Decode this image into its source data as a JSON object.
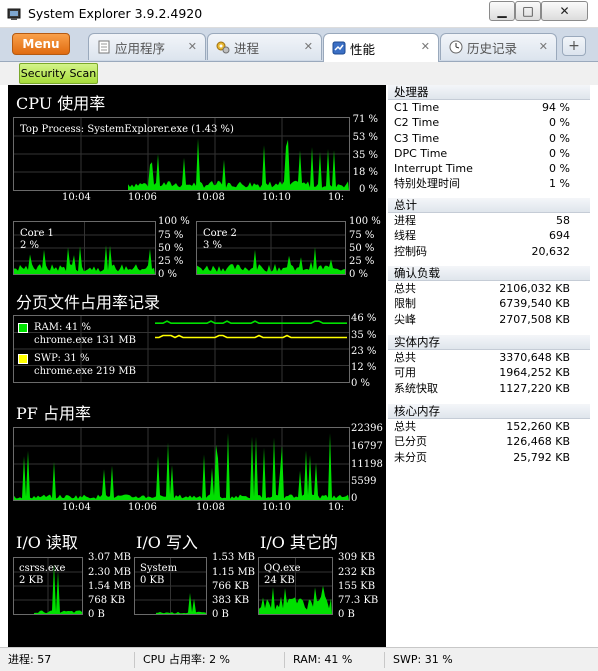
{
  "window": {
    "title": "System Explorer 3.9.2.4920",
    "min_glyph": "▁",
    "max_glyph": "□",
    "close_glyph": "✕"
  },
  "toolbar": {
    "menu_label": "Menu",
    "tabs": [
      {
        "label": "应用程序",
        "icon": "document-icon",
        "close": "✕"
      },
      {
        "label": "进程",
        "icon": "gears-icon",
        "close": "✕"
      },
      {
        "label": "性能",
        "icon": "performance-icon",
        "close": "✕"
      },
      {
        "label": "历史记录",
        "icon": "clock-icon",
        "close": "✕"
      }
    ],
    "new_tab_glyph": "+"
  },
  "scan": {
    "label": "Security Scan"
  },
  "cpu": {
    "title": "CPU 使用率",
    "top_process": "Top Process: SystemExplorer.exe (1.43 %)",
    "yticks": [
      "71 %",
      "53 %",
      "35 %",
      "18 %",
      "0 %"
    ],
    "xticks": [
      "10:04",
      "10:06",
      "10:08",
      "10:10",
      "10:"
    ],
    "core1": {
      "label": "Core 1",
      "value": "2 %"
    },
    "core2": {
      "label": "Core 2",
      "value": "3 %"
    },
    "core_yticks": [
      "100 %",
      "75 %",
      "50 %",
      "25 %",
      "0 %"
    ]
  },
  "pagefile": {
    "title": "分页文件占用率记录",
    "ram": {
      "label": "RAM: 41 %",
      "process": "chrome.exe 131 MB",
      "color": "#00e000"
    },
    "swp": {
      "label": "SWP: 31 %",
      "process": "chrome.exe 219 MB",
      "color": "#ffff00"
    },
    "yticks": [
      "46 %",
      "35 %",
      "23 %",
      "12 %",
      "0 %"
    ]
  },
  "pf": {
    "title": "PF 占用率",
    "yticks": [
      "22396",
      "16797",
      "11198",
      "5599",
      "0"
    ],
    "xticks": [
      "10:04",
      "10:06",
      "10:08",
      "10:10",
      "10:"
    ]
  },
  "io": {
    "read": {
      "title": "I/O 读取",
      "process": "csrss.exe",
      "value": "2 KB",
      "yticks": [
        "3.07 MB",
        "2.30 MB",
        "1.54 MB",
        "768 KB",
        "0 B"
      ]
    },
    "write": {
      "title": "I/O 写入",
      "process": "System",
      "value": "0 KB",
      "yticks": [
        "1.53 MB",
        "1.15 MB",
        "766 KB",
        "383 KB",
        "0 B"
      ]
    },
    "other": {
      "title": "I/O 其它的",
      "process": "QQ.exe",
      "value": "24 KB",
      "yticks": [
        "309 KB",
        "232 KB",
        "155 KB",
        "77.3 KB",
        "0 B"
      ]
    }
  },
  "info": {
    "cpu": {
      "title": "处理器",
      "rows": [
        {
          "k": "C1 Time",
          "v": "94 %"
        },
        {
          "k": "C2 Time",
          "v": "0 %"
        },
        {
          "k": "C3 Time",
          "v": "0 %"
        },
        {
          "k": "DPC Time",
          "v": "0 %"
        },
        {
          "k": "Interrupt Time",
          "v": "0 %"
        },
        {
          "k": "特别处理时间",
          "v": "1 %"
        }
      ]
    },
    "total": {
      "title": "总计",
      "rows": [
        {
          "k": "进程",
          "v": "58"
        },
        {
          "k": "线程",
          "v": "694"
        },
        {
          "k": "控制码",
          "v": "20,632"
        }
      ]
    },
    "commit": {
      "title": "确认负载",
      "rows": [
        {
          "k": "总共",
          "v": "2106,032 KB"
        },
        {
          "k": "限制",
          "v": "6739,540 KB"
        },
        {
          "k": "尖峰",
          "v": "2707,508 KB"
        }
      ]
    },
    "physical": {
      "title": "实体内存",
      "rows": [
        {
          "k": "总共",
          "v": "3370,648 KB"
        },
        {
          "k": "可用",
          "v": "1964,252 KB"
        },
        {
          "k": "系统快取",
          "v": "1127,220 KB"
        }
      ]
    },
    "kernel": {
      "title": "核心内存",
      "rows": [
        {
          "k": "总共",
          "v": "152,260 KB"
        },
        {
          "k": "已分页",
          "v": "126,468 KB"
        },
        {
          "k": "未分页",
          "v": "25,792 KB"
        }
      ]
    }
  },
  "status": {
    "processes": "进程: 57",
    "cpu": "CPU 占用率: 2 %",
    "ram": "RAM: 41 %",
    "swp": "SWP: 31 %"
  },
  "colors": {
    "graph_green": "#00e000",
    "graph_yellow": "#ffff00",
    "menu_orange": "#f08c2c",
    "scan_green": "#b8e85a"
  }
}
